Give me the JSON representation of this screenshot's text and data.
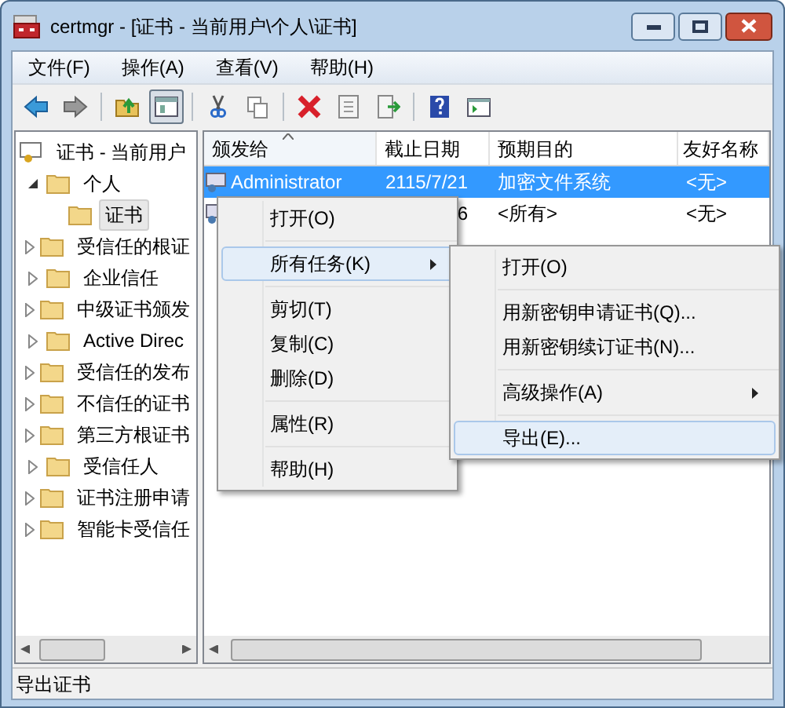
{
  "window": {
    "title": "certmgr - [证书 - 当前用户\\个人\\证书]"
  },
  "menu_bar": [
    "文件(F)",
    "操作(A)",
    "查看(V)",
    "帮助(H)"
  ],
  "toolbar": [
    {
      "pressed": false
    },
    {
      "pressed": false
    },
    {
      "pressed": false
    },
    {
      "pressed": true
    },
    {
      "pressed": false
    },
    {
      "pressed": false
    },
    {
      "pressed": false
    },
    {
      "pressed": false
    },
    {
      "pressed": false
    },
    {
      "pressed": false
    },
    {
      "pressed": false
    }
  ],
  "tree": [
    {
      "label": "证书 - 当前用户",
      "selected": false,
      "children": [
        {
          "label": "个人",
          "expanded": true,
          "selected": false,
          "children": [
            {
              "label": "证书",
              "selected": true
            }
          ]
        },
        {
          "label": "受信任的根证",
          "expanded": false,
          "selected": false
        },
        {
          "label": "企业信任",
          "expanded": false,
          "selected": false
        },
        {
          "label": "中级证书颁发",
          "expanded": false,
          "selected": false
        },
        {
          "label": "Active Direc",
          "expanded": false,
          "selected": false
        },
        {
          "label": "受信任的发布",
          "expanded": false,
          "selected": false
        },
        {
          "label": "不信任的证书",
          "expanded": false,
          "selected": false
        },
        {
          "label": "第三方根证书",
          "expanded": false,
          "selected": false
        },
        {
          "label": "受信任人",
          "expanded": false,
          "selected": false
        },
        {
          "label": "证书注册申请",
          "expanded": false,
          "selected": false
        },
        {
          "label": "智能卡受信任",
          "expanded": false,
          "selected": false
        }
      ]
    }
  ],
  "table": {
    "columns": [
      {
        "label": "颁发给",
        "sorted": true
      },
      {
        "label": "截止日期",
        "sorted": false
      },
      {
        "label": "预期目的",
        "sorted": false
      },
      {
        "label": "友好名称",
        "sorted": false
      }
    ],
    "rows": [
      {
        "selected": true,
        "cells": [
          "Administrator",
          "2115/7/21",
          "加密文件系统",
          "<无>"
        ]
      },
      {
        "selected": false,
        "cells": [
          "",
          "6",
          "<所有>",
          "<无>"
        ]
      }
    ]
  },
  "context_menu": {
    "items": [
      {
        "kind": "item",
        "label": "打开(O)",
        "selected": false,
        "submenu": false
      },
      {
        "kind": "separator"
      },
      {
        "kind": "item",
        "label": "所有任务(K)",
        "selected": true,
        "submenu": true
      },
      {
        "kind": "separator"
      },
      {
        "kind": "item",
        "label": "剪切(T)",
        "selected": false,
        "submenu": false
      },
      {
        "kind": "item",
        "label": "复制(C)",
        "selected": false,
        "submenu": false
      },
      {
        "kind": "item",
        "label": "删除(D)",
        "selected": false,
        "submenu": false
      },
      {
        "kind": "separator"
      },
      {
        "kind": "item",
        "label": "属性(R)",
        "selected": false,
        "submenu": false
      },
      {
        "kind": "separator"
      },
      {
        "kind": "item",
        "label": "帮助(H)",
        "selected": false,
        "submenu": false
      }
    ]
  },
  "submenu": {
    "items": [
      {
        "kind": "item",
        "label": "打开(O)",
        "selected": false,
        "submenu": false
      },
      {
        "kind": "separator"
      },
      {
        "kind": "item",
        "label": "用新密钥申请证书(Q)...",
        "selected": false,
        "submenu": false
      },
      {
        "kind": "item",
        "label": "用新密钥续订证书(N)...",
        "selected": false,
        "submenu": false
      },
      {
        "kind": "separator"
      },
      {
        "kind": "item",
        "label": "高级操作(A)",
        "selected": false,
        "submenu": true
      },
      {
        "kind": "separator"
      },
      {
        "kind": "item",
        "label": "导出(E)...",
        "selected": true,
        "submenu": false
      }
    ]
  },
  "status_bar": "导出证书"
}
